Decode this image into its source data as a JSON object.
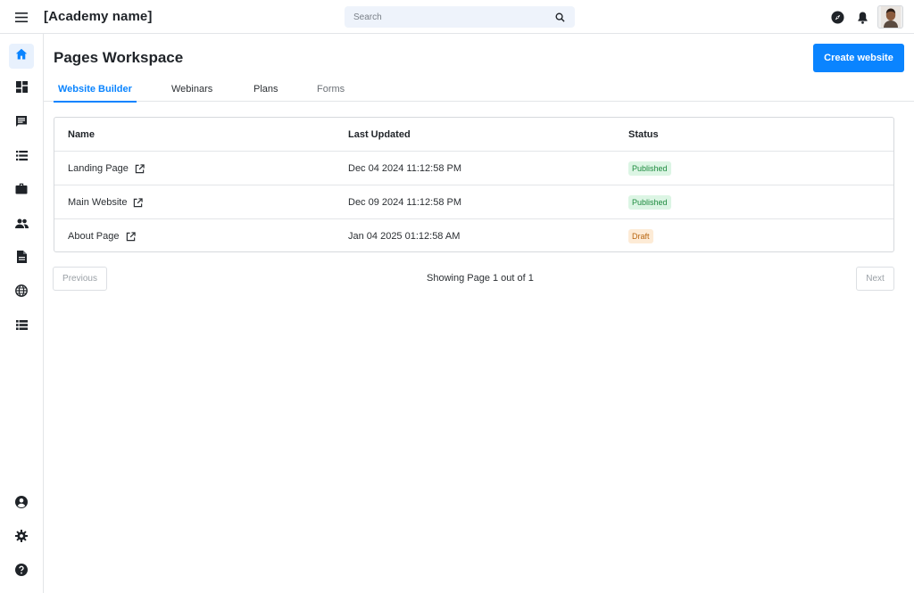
{
  "header": {
    "app_title": "[Academy name]",
    "search_placeholder": "Search"
  },
  "sidebar": {
    "items": [
      {
        "icon": "home-icon",
        "active": true
      },
      {
        "icon": "dashboard-icon"
      },
      {
        "icon": "chat-icon"
      },
      {
        "icon": "list-icon"
      },
      {
        "icon": "briefcase-icon"
      },
      {
        "icon": "people-icon"
      },
      {
        "icon": "document-icon"
      },
      {
        "icon": "globe-icon"
      },
      {
        "icon": "list-alt-icon"
      }
    ],
    "bottom_items": [
      {
        "icon": "account-circle-icon"
      },
      {
        "icon": "gear-icon"
      },
      {
        "icon": "help-icon"
      }
    ]
  },
  "main": {
    "title": "Pages Workspace",
    "create_button": "Create website",
    "tabs": [
      {
        "label": "Website Builder",
        "active": true
      },
      {
        "label": "Webinars"
      },
      {
        "label": "Plans"
      },
      {
        "label": "Forms"
      }
    ],
    "table": {
      "columns": [
        "Name",
        "Last Updated",
        "Status"
      ],
      "rows": [
        {
          "name": "Landing Page",
          "updated": "Dec 04 2024 11:12:58 PM",
          "status": "Published"
        },
        {
          "name": "Main Website",
          "updated": "Dec 09 2024 11:12:58 PM",
          "status": "Published"
        },
        {
          "name": "About Page",
          "updated": "Jan 04 2025 01:12:58 AM",
          "status": "Draft"
        }
      ]
    },
    "pagination": {
      "previous": "Previous",
      "text": "Showing Page 1 out of 1",
      "next": "Next"
    }
  },
  "colors": {
    "accent": "#0a84ff",
    "published_bg": "#dcf5e4",
    "published_fg": "#1c8a3e",
    "draft_bg": "#fdebd6",
    "draft_fg": "#b8650f"
  }
}
